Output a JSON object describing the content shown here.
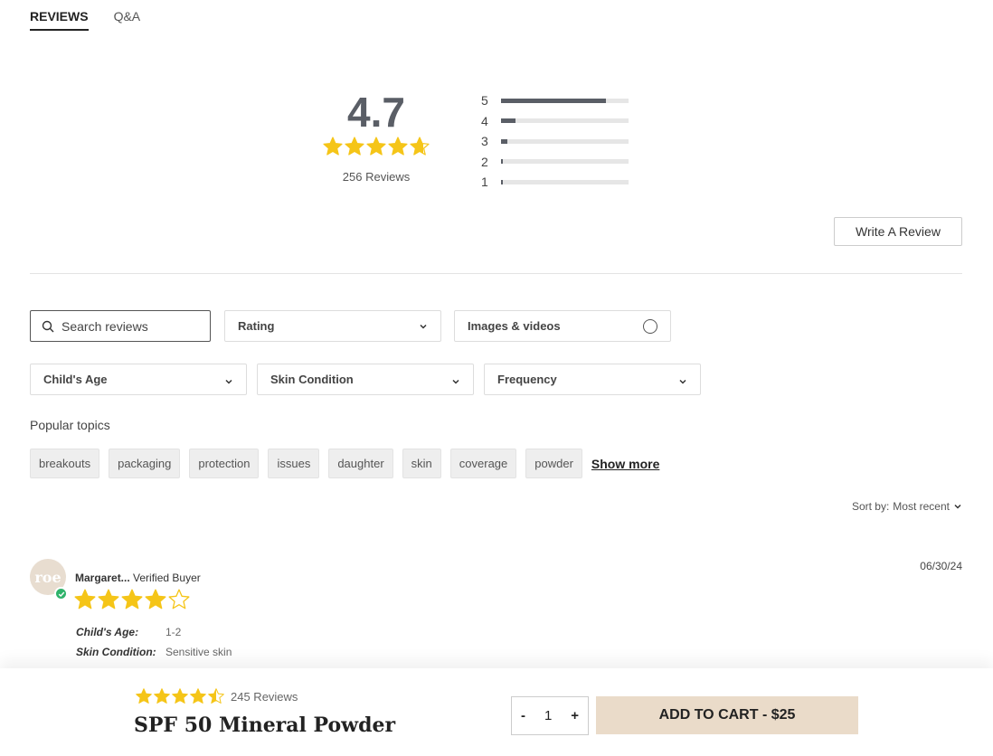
{
  "tabs": [
    {
      "label": "REVIEWS",
      "active": true
    },
    {
      "label": "Q&A",
      "active": false
    }
  ],
  "summary": {
    "average": "4.7",
    "rating_value": 4.7,
    "total_label": "256 Reviews",
    "distribution": [
      {
        "label": "5",
        "fraction": 0.82
      },
      {
        "label": "4",
        "fraction": 0.11
      },
      {
        "label": "3",
        "fraction": 0.05
      },
      {
        "label": "2",
        "fraction": 0.01
      },
      {
        "label": "1",
        "fraction": 0.01
      }
    ]
  },
  "write_review_label": "Write A Review",
  "filters": {
    "search_placeholder": "Search reviews",
    "rating": "Rating",
    "images_videos": "Images & videos",
    "childs_age": "Child's Age",
    "skin_condition": "Skin Condition",
    "frequency": "Frequency"
  },
  "topics": {
    "label": "Popular topics",
    "items": [
      "breakouts",
      "packaging",
      "protection",
      "issues",
      "daughter",
      "skin",
      "coverage",
      "powder"
    ],
    "show_more": "Show more"
  },
  "sort": {
    "label": "Sort by:",
    "value": "Most recent"
  },
  "review": {
    "avatar_text": "roe",
    "author": "Margaret...",
    "badge": "Verified Buyer",
    "rating": 4,
    "date": "06/30/24",
    "attributes": [
      {
        "key": "Child's Age:",
        "value": "1-2"
      },
      {
        "key": "Skin Condition:",
        "value": "Sensitive skin"
      }
    ]
  },
  "sticky": {
    "rating_value": 4.5,
    "reviews_label": "245 Reviews",
    "product_name": "SPF 50 Mineral Powder",
    "qty_minus": "-",
    "qty_value": "1",
    "qty_plus": "+",
    "add_to_cart": "ADD TO CART - $25"
  },
  "colors": {
    "star": "#f5c518",
    "bar": "#5a5e66",
    "cta": "#eadbc9",
    "verified": "#2fb36b"
  }
}
